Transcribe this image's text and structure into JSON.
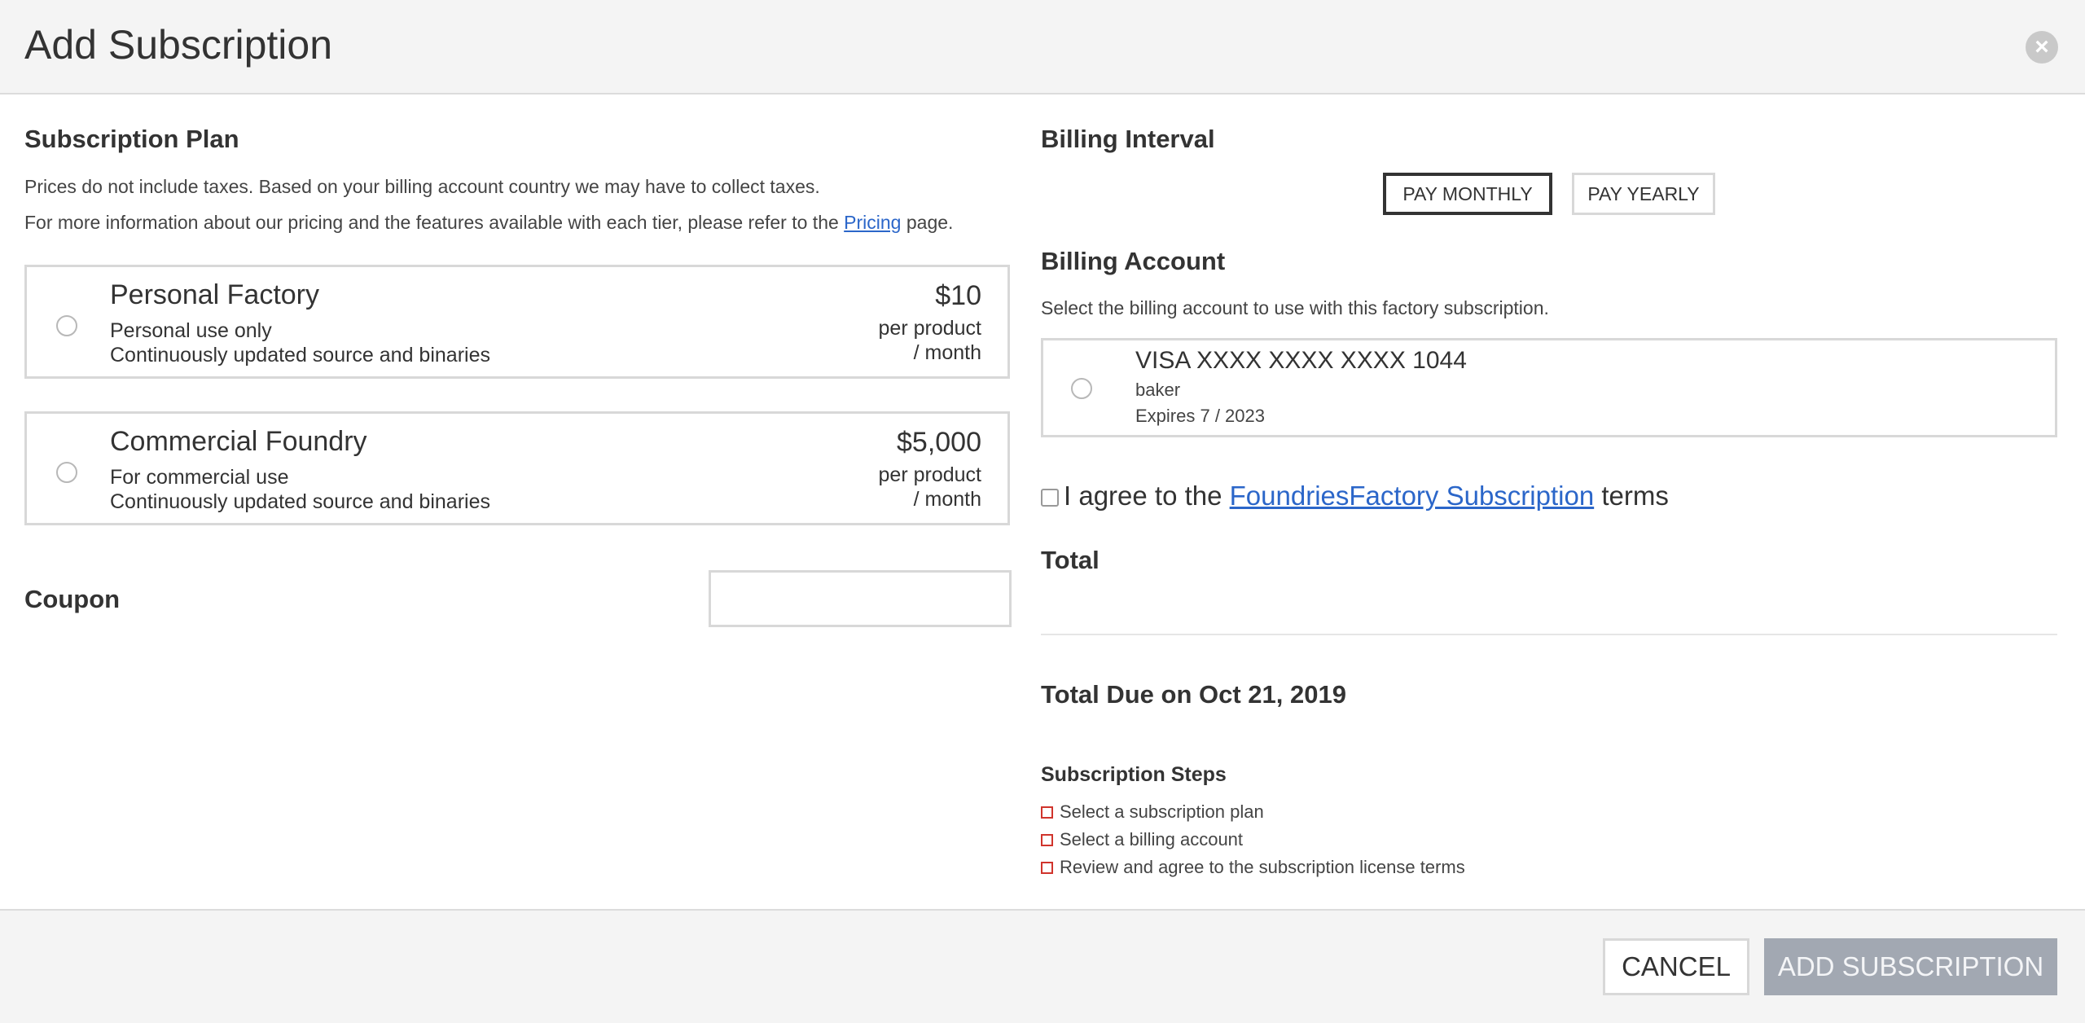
{
  "dialog": {
    "title": "Add Subscription",
    "close_icon": "close-icon"
  },
  "plan_section": {
    "title": "Subscription Plan",
    "info_line1": "Prices do not include taxes. Based on your billing account country we may have to collect taxes.",
    "info_line2_prefix": "For more information about our pricing and the features available with each tier, please refer to the ",
    "info_line2_link": "Pricing",
    "info_line2_suffix": " page.",
    "plans": [
      {
        "name": "Personal Factory",
        "line1": "Personal use only",
        "line2": "Continuously updated source and binaries",
        "price": "$10",
        "per1": "per product",
        "per2": "/ month",
        "selected": false
      },
      {
        "name": "Commercial Foundry",
        "line1": "For commercial use",
        "line2": "Continuously updated source and binaries",
        "price": "$5,000",
        "per1": "per product",
        "per2": "/ month",
        "selected": false
      }
    ]
  },
  "coupon": {
    "label": "Coupon",
    "value": "",
    "placeholder": ""
  },
  "billing_interval": {
    "title": "Billing Interval",
    "monthly_label": "PAY MONTHLY",
    "yearly_label": "PAY YEARLY",
    "selected": "monthly"
  },
  "billing_account": {
    "title": "Billing Account",
    "description": "Select the billing account to use with this factory subscription.",
    "card_number": "VISA XXXX XXXX XXXX 1044",
    "holder": "baker",
    "expires": "Expires 7 / 2023",
    "selected": false
  },
  "agreement": {
    "prefix": "I agree to the ",
    "link": "FoundriesFactory Subscription",
    "suffix": " terms",
    "checked": false
  },
  "total": {
    "title": "Total",
    "due_label": "Total Due on Oct 21, 2019"
  },
  "steps": {
    "title": "Subscription Steps",
    "items": [
      "Select a subscription plan",
      "Select a billing account",
      "Review and agree to the subscription license terms"
    ]
  },
  "footer": {
    "cancel_label": "CANCEL",
    "add_label": "ADD SUBSCRIPTION"
  },
  "colors": {
    "header_bg": "#f4f4f4",
    "link": "#2b66c9",
    "step_marker": "#d0342c",
    "primary_disabled": "#a2a8b2"
  }
}
